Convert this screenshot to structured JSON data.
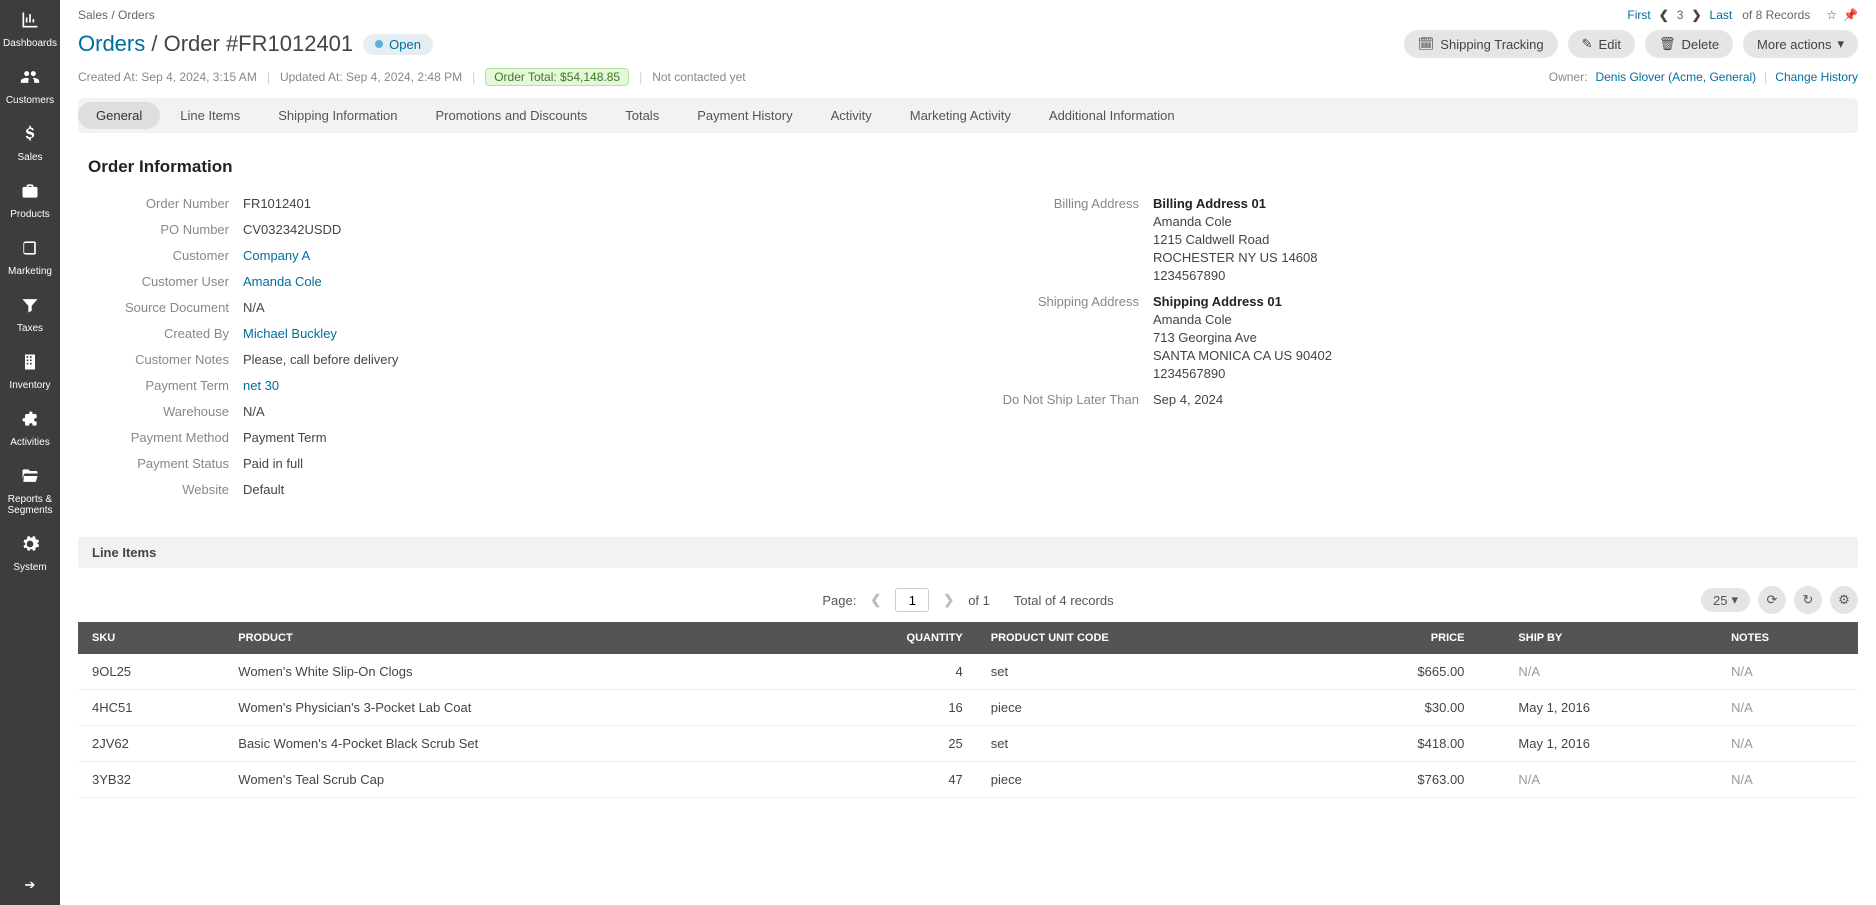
{
  "sidebar": {
    "items": [
      {
        "label": "Dashboards",
        "icon": "bar-chart"
      },
      {
        "label": "Customers",
        "icon": "users"
      },
      {
        "label": "Sales",
        "icon": "dollar"
      },
      {
        "label": "Products",
        "icon": "briefcase"
      },
      {
        "label": "Marketing",
        "icon": "book"
      },
      {
        "label": "Taxes",
        "icon": "filter"
      },
      {
        "label": "Inventory",
        "icon": "building"
      },
      {
        "label": "Activities",
        "icon": "puzzle"
      },
      {
        "label": "Reports & Segments",
        "icon": "folder-open"
      },
      {
        "label": "System",
        "icon": "gear"
      }
    ]
  },
  "breadcrumb": {
    "parent": "Sales",
    "current": "Orders"
  },
  "pager": {
    "first_label": "First",
    "prev_glyph": "❮",
    "page": "3",
    "next_glyph": "❯",
    "last_label": "Last",
    "records_text": "of 8 Records"
  },
  "title": {
    "parent": "Orders",
    "current": "Order #FR1012401",
    "status": "Open"
  },
  "actions": {
    "shipping_tracking": "Shipping Tracking",
    "edit": "Edit",
    "delete": "Delete",
    "more": "More actions"
  },
  "meta": {
    "created_at_label": "Created At:",
    "created_at_value": "Sep 4, 2024, 3:15 AM",
    "updated_at_label": "Updated At:",
    "updated_at_value": "Sep 4, 2024, 2:48 PM",
    "order_total": "Order Total: $54,148.85",
    "contact_status": "Not contacted yet",
    "owner_label": "Owner:",
    "owner_name": "Denis Glover (Acme, General)",
    "change_history": "Change History"
  },
  "tabs": [
    "General",
    "Line Items",
    "Shipping Information",
    "Promotions and Discounts",
    "Totals",
    "Payment History",
    "Activity",
    "Marketing Activity",
    "Additional Information"
  ],
  "section_title": "Order Information",
  "info_left": {
    "order_number_l": "Order Number",
    "order_number_v": "FR1012401",
    "po_number_l": "PO Number",
    "po_number_v": "CV032342USDD",
    "customer_l": "Customer",
    "customer_v": "Company A",
    "customer_user_l": "Customer User",
    "customer_user_v": "Amanda Cole",
    "source_doc_l": "Source Document",
    "source_doc_v": "N/A",
    "created_by_l": "Created By",
    "created_by_v": "Michael Buckley",
    "notes_l": "Customer Notes",
    "notes_v": "Please, call before delivery",
    "payment_term_l": "Payment Term",
    "payment_term_v": "net 30",
    "warehouse_l": "Warehouse",
    "warehouse_v": "N/A",
    "payment_method_l": "Payment Method",
    "payment_method_v": "Payment Term",
    "payment_status_l": "Payment Status",
    "payment_status_v": "Paid in full",
    "website_l": "Website",
    "website_v": "Default"
  },
  "info_right": {
    "billing_l": "Billing Address",
    "billing_title": "Billing Address 01",
    "billing_name": "Amanda Cole",
    "billing_street": "1215 Caldwell Road",
    "billing_locality": "ROCHESTER NY US 14608",
    "billing_phone": "1234567890",
    "shipping_l": "Shipping Address",
    "shipping_title": "Shipping Address 01",
    "shipping_name": "Amanda Cole",
    "shipping_street": "713 Georgina Ave",
    "shipping_locality": "SANTA MONICA CA US 90402",
    "shipping_phone": "1234567890",
    "ship_later_l": "Do Not Ship Later Than",
    "ship_later_v": "Sep 4, 2024"
  },
  "line_items_section_label": "Line Items",
  "grid": {
    "page_label": "Page:",
    "page_value": "1",
    "of_label": "of 1",
    "total_label": "Total of 4 records",
    "page_size": "25",
    "columns": {
      "sku": "SKU",
      "product": "PRODUCT",
      "qty": "QUANTITY",
      "unit": "PRODUCT UNIT CODE",
      "price": "PRICE",
      "shipby": "SHIP BY",
      "notes": "NOTES"
    },
    "rows": [
      {
        "sku": "9OL25",
        "product": "Women's White Slip-On Clogs",
        "qty": "4",
        "unit": "set",
        "price": "$665.00",
        "shipby": "N/A",
        "notes": "N/A"
      },
      {
        "sku": "4HC51",
        "product": "Women's Physician's 3-Pocket Lab Coat",
        "qty": "16",
        "unit": "piece",
        "price": "$30.00",
        "shipby": "May 1, 2016",
        "notes": "N/A"
      },
      {
        "sku": "2JV62",
        "product": "Basic Women's 4-Pocket Black Scrub Set",
        "qty": "25",
        "unit": "set",
        "price": "$418.00",
        "shipby": "May 1, 2016",
        "notes": "N/A"
      },
      {
        "sku": "3YB32",
        "product": "Women's Teal Scrub Cap",
        "qty": "47",
        "unit": "piece",
        "price": "$763.00",
        "shipby": "N/A",
        "notes": "N/A"
      }
    ]
  }
}
